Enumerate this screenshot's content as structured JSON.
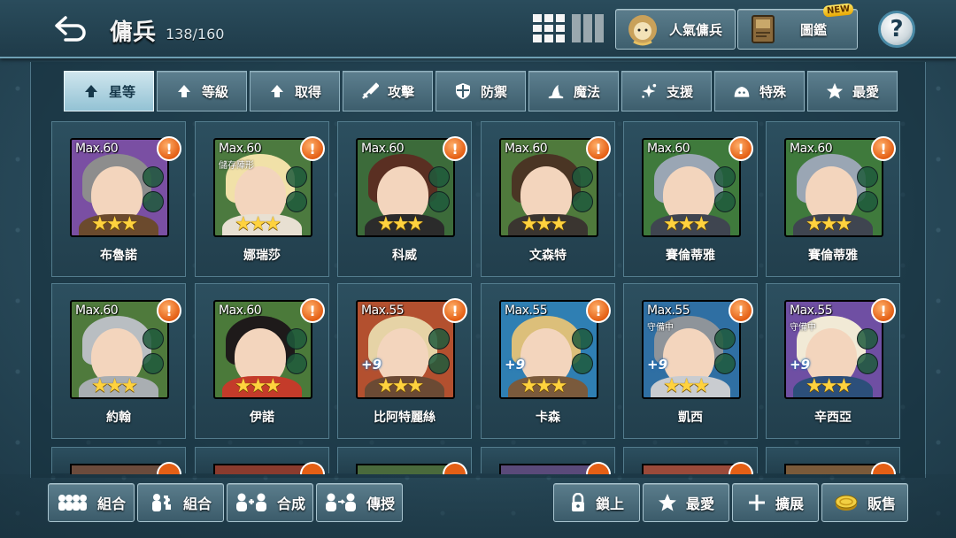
{
  "header": {
    "title": "傭兵",
    "count": "138/160",
    "popular_label": "人氣傭兵",
    "codex_label": "圖鑑",
    "new_badge": "NEW",
    "help_label": "?"
  },
  "filters": [
    {
      "label": "星等",
      "icon": "arrow-up-icon",
      "active": true
    },
    {
      "label": "等級",
      "icon": "arrow-up-icon",
      "active": false
    },
    {
      "label": "取得",
      "icon": "arrow-up-icon",
      "active": false
    },
    {
      "label": "攻擊",
      "icon": "sword-icon",
      "active": false
    },
    {
      "label": "防禦",
      "icon": "shield-icon",
      "active": false
    },
    {
      "label": "魔法",
      "icon": "wizard-hat-icon",
      "active": false
    },
    {
      "label": "支援",
      "icon": "sparkle-icon",
      "active": false
    },
    {
      "label": "特殊",
      "icon": "slime-icon",
      "active": false
    },
    {
      "label": "最愛",
      "icon": "star-icon",
      "active": false
    }
  ],
  "cards": [
    {
      "name": "布魯諾",
      "max": "Max.60",
      "sub": "",
      "plus": "",
      "stars": "★★★",
      "alert": "!",
      "bg": "#7a4fa3",
      "hair": "#8d8d8d",
      "body": "#6b4a2d"
    },
    {
      "name": "娜瑞莎",
      "max": "Max.60",
      "sub": "儲存陣形",
      "plus": "",
      "stars": "★★★",
      "alert": "!",
      "bg": "#4c7a3f",
      "hair": "#f1e1a8",
      "body": "#e8e0d2"
    },
    {
      "name": "科威",
      "max": "Max.60",
      "sub": "",
      "plus": "",
      "stars": "★★★",
      "alert": "!",
      "bg": "#3c6b3a",
      "hair": "#5a2f22",
      "body": "#2b2b2b"
    },
    {
      "name": "文森特",
      "max": "Max.60",
      "sub": "",
      "plus": "",
      "stars": "★★★",
      "alert": "!",
      "bg": "#4f7a3c",
      "hair": "#4a3524",
      "body": "#3a3530"
    },
    {
      "name": "賽倫蒂雅",
      "max": "Max.60",
      "sub": "",
      "plus": "",
      "stars": "★★★",
      "alert": "!",
      "bg": "#3f7a3c",
      "hair": "#9aa6b4",
      "body": "#3f4550"
    },
    {
      "name": "賽倫蒂雅",
      "max": "Max.60",
      "sub": "",
      "plus": "",
      "stars": "★★★",
      "alert": "!",
      "bg": "#3f7a3c",
      "hair": "#9aa6b4",
      "body": "#3f4550"
    },
    {
      "name": "約翰",
      "max": "Max.60",
      "sub": "",
      "plus": "",
      "stars": "★★★",
      "alert": "!",
      "bg": "#4f7a3c",
      "hair": "#b9bec2",
      "body": "#a9aeb2"
    },
    {
      "name": "伊諾",
      "max": "Max.60",
      "sub": "",
      "plus": "",
      "stars": "★★★",
      "alert": "!",
      "bg": "#4b7a3a",
      "hair": "#1e1a1a",
      "body": "#c43b2a"
    },
    {
      "name": "比阿特麗絲",
      "max": "Max.55",
      "sub": "",
      "plus": "+9",
      "stars": "★★★",
      "alert": "!",
      "bg": "#b3502f",
      "hair": "#e6d3a6",
      "body": "#6b4a34"
    },
    {
      "name": "卡森",
      "max": "Max.55",
      "sub": "",
      "plus": "+9",
      "stars": "★★★",
      "alert": "!",
      "bg": "#2f7fb3",
      "hair": "#dcbf7a",
      "body": "#7a5a3c"
    },
    {
      "name": "凱西",
      "max": "Max.55",
      "sub": "守備中",
      "plus": "+9",
      "stars": "★★★",
      "alert": "!",
      "bg": "#2f6fa3",
      "hair": "#8e949a",
      "body": "#c9ccd0"
    },
    {
      "name": "辛西亞",
      "max": "Max.55",
      "sub": "守備中",
      "plus": "+9",
      "stars": "★★★",
      "alert": "!",
      "bg": "#6f4fa3",
      "hair": "#f1ead6",
      "body": "#2c4f7a"
    }
  ],
  "bottom": {
    "group1_label": "組合",
    "group2_label": "組合",
    "merge_label": "合成",
    "transfer_label": "傳授",
    "lock_label": "鎖上",
    "favorite_label": "最愛",
    "expand_label": "擴展",
    "sell_label": "販售"
  }
}
